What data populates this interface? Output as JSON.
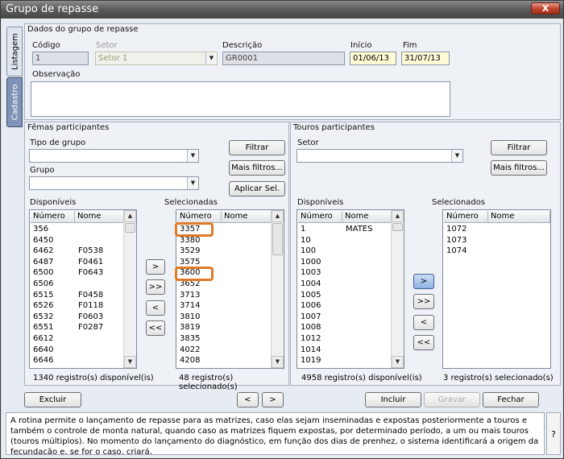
{
  "window": {
    "title": "Grupo de repasse",
    "close": "X"
  },
  "side_tabs": [
    "Listagem",
    "Cadastro"
  ],
  "dados": {
    "section": "Dados do grupo de repasse",
    "codigo_label": "Código",
    "codigo_value": "1",
    "setor_label": "Setor",
    "setor_value": "Setor 1",
    "descricao_label": "Descrição",
    "descricao_value": "GR0001",
    "inicio_label": "Início",
    "inicio_value": "01/06/13",
    "fim_label": "Fim",
    "fim_value": "31/07/13",
    "observacao_label": "Observação",
    "observacao_value": ""
  },
  "femeas": {
    "section": "Fêmas participantes",
    "tipo_label": "Tipo de grupo",
    "grupo_label": "Grupo",
    "filtrar": "Filtrar",
    "mais_filtros": "Mais filtros...",
    "aplicar": "Aplicar Sel.",
    "disponiveis_label": "Disponíveis",
    "selecionadas_label": "Selecionadas",
    "col_numero": "Número",
    "col_nome": "Nome",
    "disponiveis": [
      [
        "356",
        ""
      ],
      [
        "6450",
        ""
      ],
      [
        "6462",
        "F0538"
      ],
      [
        "6487",
        "F0461"
      ],
      [
        "6500",
        "F0643"
      ],
      [
        "6506",
        ""
      ],
      [
        "6515",
        "F0458"
      ],
      [
        "6526",
        "F0118"
      ],
      [
        "6532",
        "F0603"
      ],
      [
        "6551",
        "F0287"
      ],
      [
        "6612",
        ""
      ],
      [
        "6640",
        ""
      ],
      [
        "6646",
        ""
      ]
    ],
    "selecionadas": [
      "3357",
      "3380",
      "3529",
      "3575",
      "3600",
      "3652",
      "3713",
      "3714",
      "3810",
      "3819",
      "3835",
      "4022",
      "4208"
    ],
    "move_buttons": [
      ">",
      ">>",
      "<",
      "<<"
    ],
    "status_disp": "1340 registro(s) disponível(is)",
    "status_sel": "48 registro(s) selecionado(s)"
  },
  "touros": {
    "section": "Touros participantes",
    "setor_label": "Setor",
    "filtrar": "Filtrar",
    "mais_filtros": "Mais filtros...",
    "disponiveis_label": "Disponíveis",
    "selecionados_label": "Selecionados",
    "col_numero": "Número",
    "col_nome": "Nome",
    "disponiveis": [
      [
        "1",
        "MATES"
      ],
      [
        "10",
        ""
      ],
      [
        "100",
        ""
      ],
      [
        "1000",
        ""
      ],
      [
        "1003",
        ""
      ],
      [
        "1004",
        ""
      ],
      [
        "1005",
        ""
      ],
      [
        "1006",
        ""
      ],
      [
        "1007",
        ""
      ],
      [
        "1008",
        ""
      ],
      [
        "1012",
        ""
      ],
      [
        "1014",
        ""
      ],
      [
        "1019",
        ""
      ]
    ],
    "selecionados": [
      "1072",
      "1073",
      "1074"
    ],
    "move_buttons": [
      ">",
      ">>",
      "<",
      "<<"
    ],
    "status_disp": "4958 registro(s) disponível(is)",
    "status_sel": "3 registro(s) selecionado(s)"
  },
  "toolbar": {
    "excluir": "Excluir",
    "prev": "<",
    "next": ">",
    "incluir": "Incluir",
    "gravar": "Gravar",
    "fechar": "Fechar"
  },
  "footer": {
    "text": "A rotina permite o lançamento de repasse para as matrizes, caso elas sejam inseminadas e expostas posteriormente a touros e também o controle de monta natural, quando caso as matrizes fiquem expostas, por determinado período, a um ou mais touros (touros múltiplos). No momento do lançamento do diagnóstico, em função dos dias de prenhez, o sistema identificará a origem da fecundação e, se for o caso, criará,",
    "help": "?"
  },
  "colors": {
    "highlight": "#e07a26",
    "titlebar": "#5d5d5d",
    "active_tab": "#7e93b7"
  }
}
